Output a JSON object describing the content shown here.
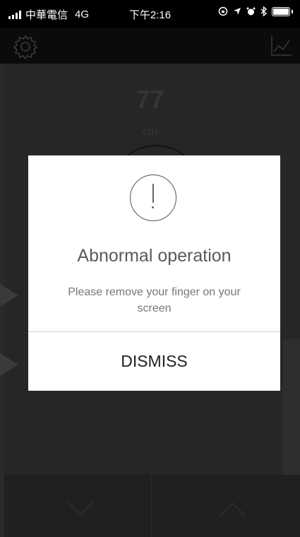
{
  "status_bar": {
    "carrier": "中華電信",
    "network": "4G",
    "time": "下午2:16"
  },
  "header": {
    "settings_icon": "gear-icon",
    "chart_icon": "line-chart-icon"
  },
  "background": {
    "value": "77",
    "unit": "cm"
  },
  "dialog": {
    "icon": "exclamation-circle-icon",
    "title": "Abnormal operation",
    "message": "Please remove your finger on your screen",
    "dismiss_label": "DISMISS"
  }
}
